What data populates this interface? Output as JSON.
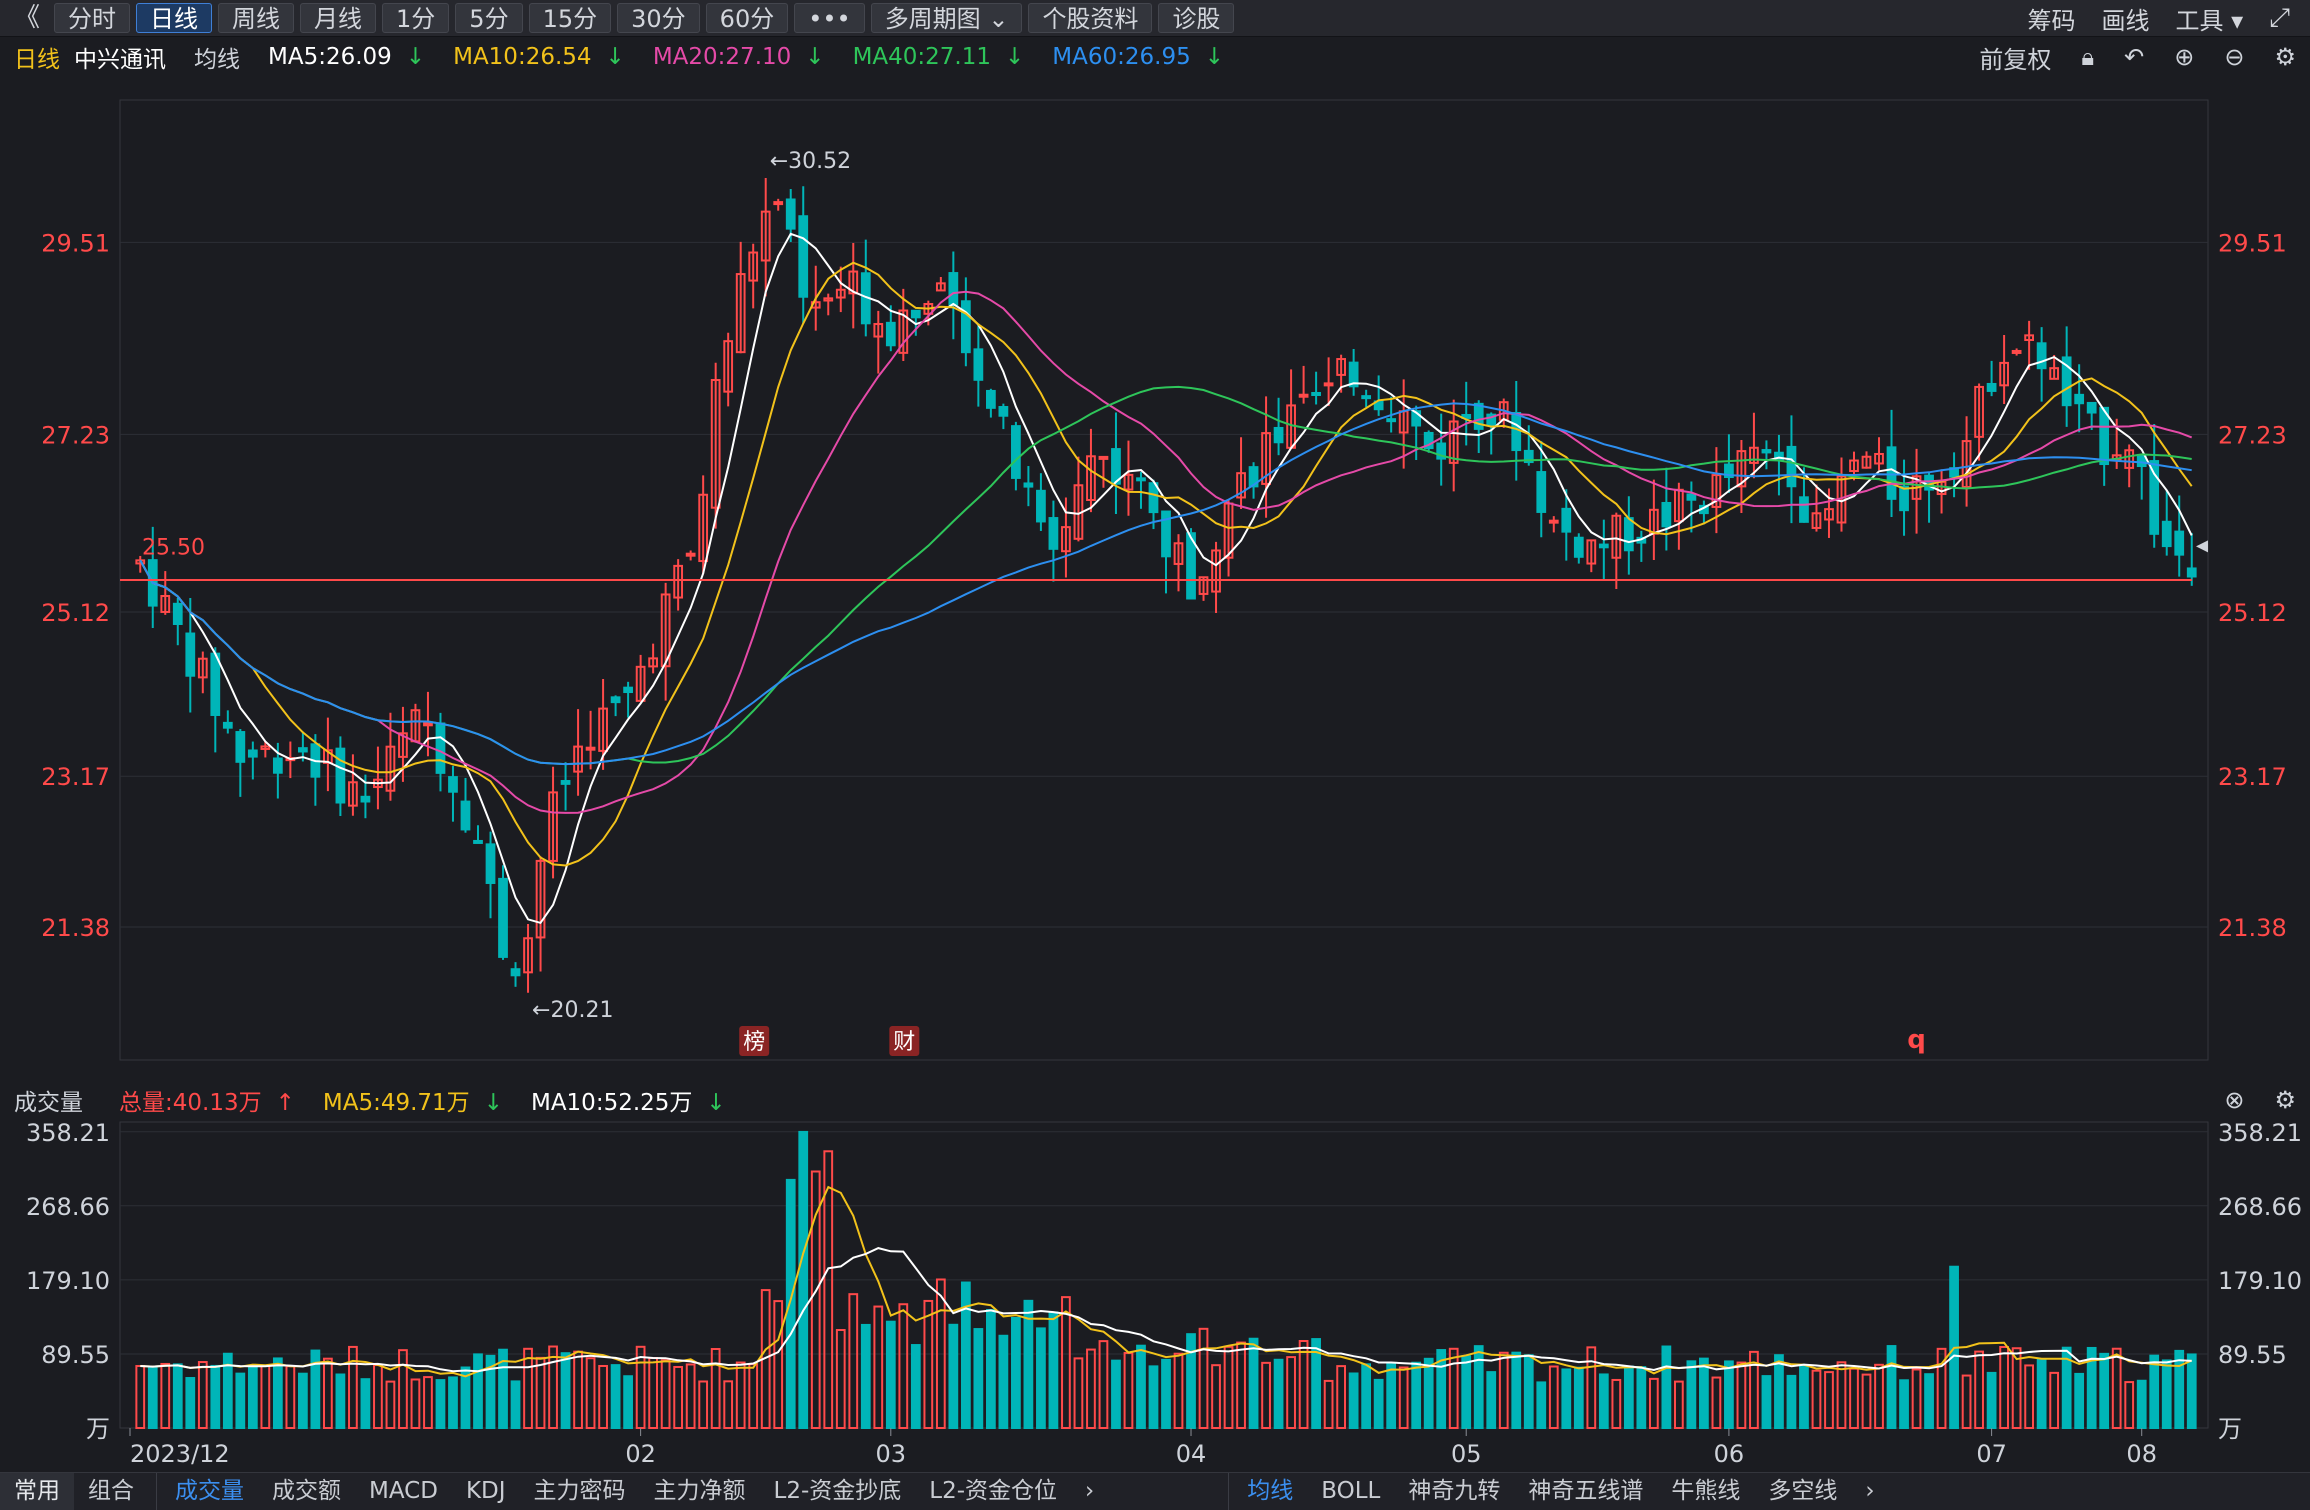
{
  "toolbar": {
    "collapse": "《",
    "periods": [
      "分时",
      "日线",
      "周线",
      "月线",
      "1分",
      "5分",
      "15分",
      "30分",
      "60分"
    ],
    "active_period": "日线",
    "more": "•••",
    "multi": "多周期图",
    "profile": "个股资料",
    "diagnose": "诊股",
    "right": {
      "chips": "筹码",
      "draw": "画线",
      "tools": "工具",
      "expand_icon": "expand-icon"
    }
  },
  "main_header": {
    "period": "日线",
    "stock": "中兴通讯",
    "ma_label": "均线",
    "ma": [
      {
        "text": "MA5:26.09",
        "color": "#ffffff",
        "arrow": "↓"
      },
      {
        "text": "MA10:26.54",
        "color": "#f2c21b",
        "arrow": "↓"
      },
      {
        "text": "MA20:27.10",
        "color": "#e54aa8",
        "arrow": "↓"
      },
      {
        "text": "MA40:27.11",
        "color": "#2ec55a",
        "arrow": "↓"
      },
      {
        "text": "MA60:26.95",
        "color": "#2d8ff0",
        "arrow": "↓"
      }
    ],
    "adjust": "前复权"
  },
  "price_axis": [
    {
      "label": "29.51",
      "value": 29.51
    },
    {
      "label": "27.23",
      "value": 27.23
    },
    {
      "label": "25.12",
      "value": 25.12
    },
    {
      "label": "23.17",
      "value": 23.17
    },
    {
      "label": "21.38",
      "value": 21.38
    }
  ],
  "annotations": {
    "high": "←30.52",
    "low": "←20.21",
    "ref_price": "25.50",
    "ref_line": 25.5,
    "badge_rank": "榜",
    "badge_fin": "财",
    "badge_q": "q"
  },
  "vol_header": {
    "title": "成交量",
    "total": "总量:40.13万",
    "ma5": "MA5:49.71万",
    "ma10": "MA10:52.25万"
  },
  "vol_axis": [
    {
      "label": "358.21",
      "value": 358.21
    },
    {
      "label": "268.66",
      "value": 268.66
    },
    {
      "label": "179.10",
      "value": 179.1
    },
    {
      "label": "89.55",
      "value": 89.55
    }
  ],
  "vol_unit": "万",
  "x_axis": [
    "2023/12",
    "02",
    "03",
    "04",
    "05",
    "06",
    "07",
    "08"
  ],
  "bottom": {
    "left_tabs": [
      "常用",
      "组合"
    ],
    "ind_tabs": [
      "成交量",
      "成交额",
      "MACD",
      "KDJ",
      "主力密码",
      "主力净额",
      "L2-资金抄底",
      "L2-资金仓位"
    ],
    "ind_selected": "成交量",
    "ov_tabs": [
      "均线",
      "BOLL",
      "神奇九转",
      "神奇五线谱",
      "牛熊线",
      "多空线"
    ],
    "ov_selected": "均线",
    "more": "›"
  },
  "colors": {
    "up": "#ff4a4a",
    "down": "#00b5b8",
    "grid": "#2d2f36"
  },
  "chart_data": {
    "type": "candlestick",
    "x_axis_labels": [
      "2023/12",
      "02",
      "03",
      "04",
      "05",
      "06",
      "07",
      "08"
    ],
    "price_ylim": [
      19.8,
      31.2
    ],
    "volume_ylim": [
      0,
      370
    ],
    "volume_unit": "万",
    "ma_close": {
      "MA5": 26.09,
      "MA10": 26.54,
      "MA20": 27.1,
      "MA40": 27.11,
      "MA60": 26.95
    },
    "high": 30.52,
    "low": 20.21,
    "reference_price": 25.5,
    "note": "Bars reconstructed at approximate daily resolution; one entry per trading day, fields [open, high, low, close, volume_wan]."
  }
}
